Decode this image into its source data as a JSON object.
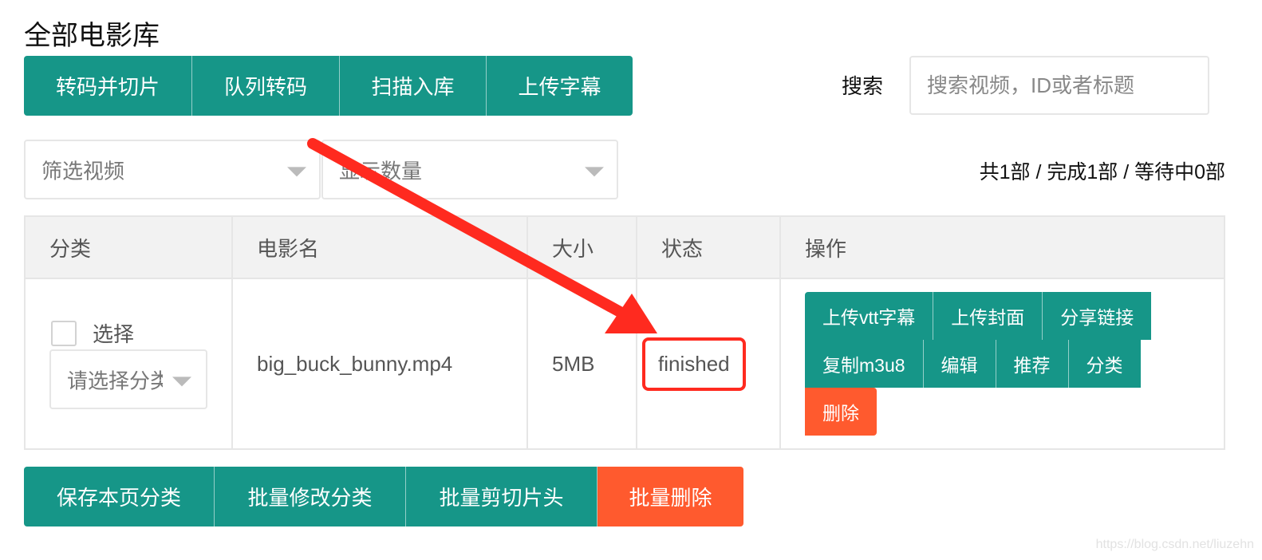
{
  "page": {
    "title": "全部电影库",
    "watermark": "https://blog.csdn.net/liuzehn"
  },
  "toolbar": {
    "buttons": [
      {
        "label": "转码并切片"
      },
      {
        "label": "队列转码"
      },
      {
        "label": "扫描入库"
      },
      {
        "label": "上传字幕"
      }
    ]
  },
  "search": {
    "label": "搜索",
    "placeholder": "搜索视频，ID或者标题",
    "value": ""
  },
  "filters": {
    "filter_select": "筛选视频",
    "count_select": "显示数量"
  },
  "summary": "共1部 / 完成1部 / 等待中0部",
  "table": {
    "headers": [
      "分类",
      "电影名",
      "大小",
      "状态",
      "操作"
    ],
    "rows": [
      {
        "select_label": "选择",
        "checked": false,
        "category_placeholder": "请选择分类",
        "name": "big_buck_bunny.mp4",
        "size": "5MB",
        "status": "finished",
        "actions": {
          "row1": [
            "上传vtt字幕",
            "上传封面",
            "分享链接"
          ],
          "row2": [
            "复制m3u8",
            "编辑",
            "推荐",
            "分类"
          ],
          "delete": "删除"
        }
      }
    ]
  },
  "bottom": {
    "buttons": [
      {
        "label": "保存本页分类"
      },
      {
        "label": "批量修改分类"
      },
      {
        "label": "批量剪切片头"
      },
      {
        "label": "批量删除"
      }
    ]
  },
  "colors": {
    "primary": "#169688",
    "danger": "#ff5a2e",
    "annotation": "#ff2a1f"
  }
}
